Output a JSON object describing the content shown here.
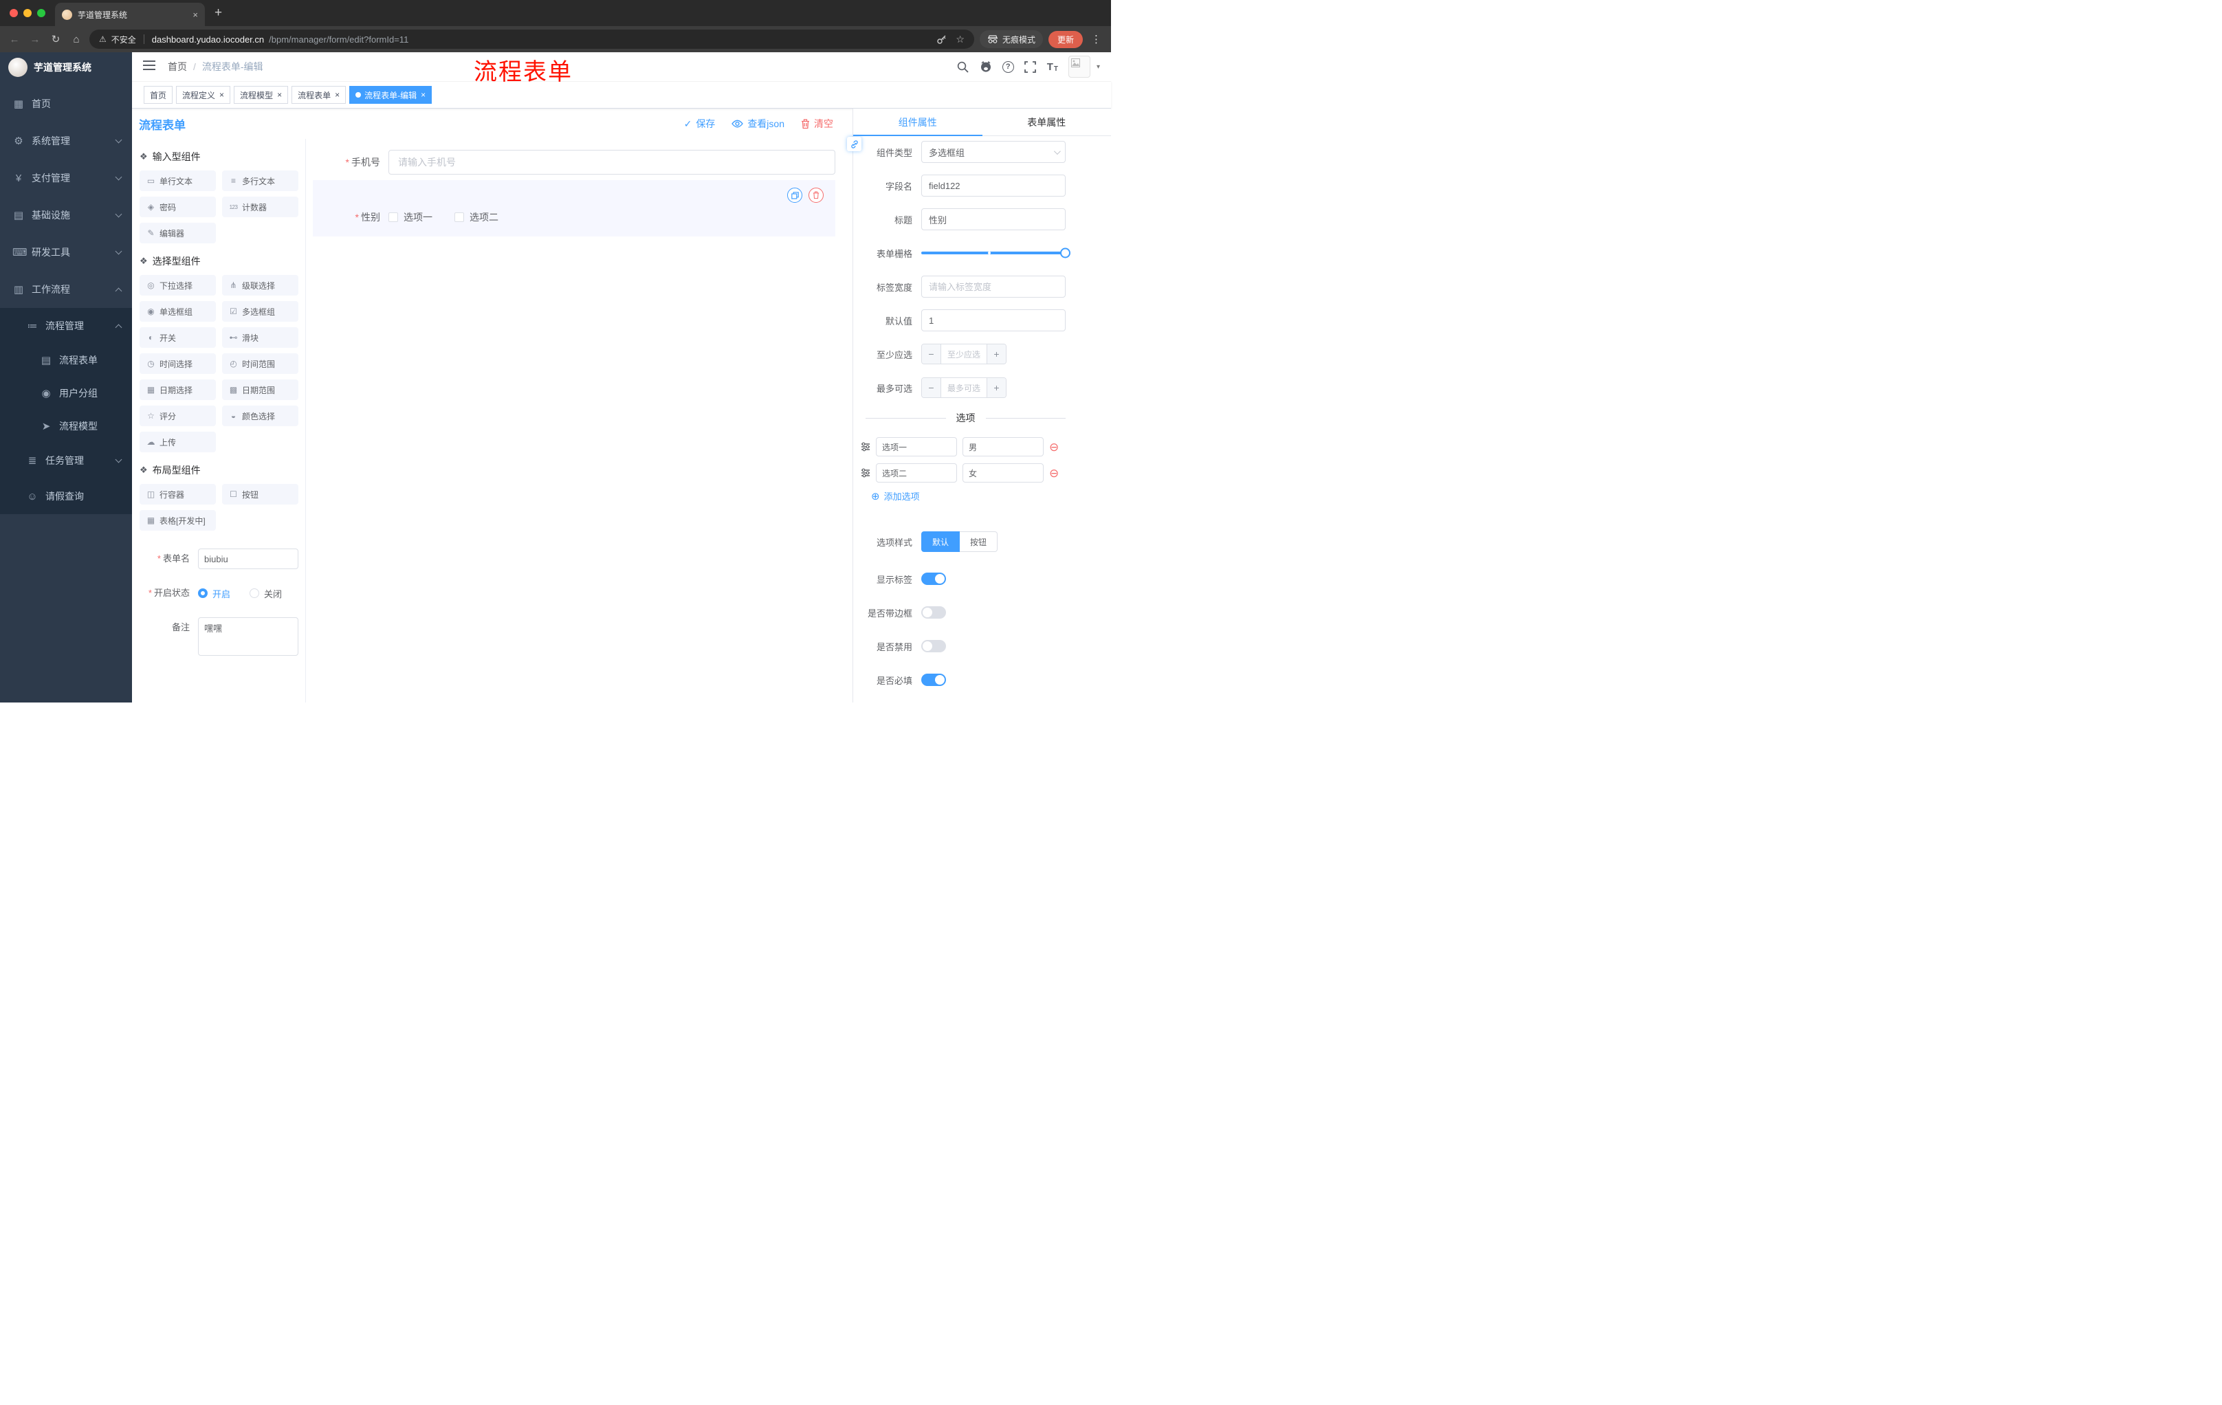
{
  "ui": {
    "asterisk": "*",
    "slash": "/",
    "close": "×",
    "plus_tab": "+",
    "dots": "⋮",
    "caret": "▾",
    "arrow_back": "←",
    "arrow_forward": "→",
    "reload": "↻",
    "home": "⌂",
    "warning": "⚠",
    "star": "☆",
    "minus": "−",
    "plus": "+",
    "add_circle": "⊕",
    "remove_circle": "⊖",
    "check": "✓",
    "question": "?",
    "t": "T"
  },
  "colors": {
    "accent": "#409eff",
    "danger": "#f56c6c",
    "annotation_red": "#ff1200",
    "sidebar_bg": "#2d3a4b",
    "submenu_bg": "#1f2d3d"
  },
  "browser": {
    "tab": {
      "title": "芋道管理系统"
    },
    "address": {
      "security": "不安全",
      "url_host": "dashboard.yudao.iocoder.cn",
      "url_path": "/bpm/manager/form/edit?formId=11"
    },
    "incognito": "无痕模式",
    "update": "更新"
  },
  "sidebar": {
    "logo_title": "芋道管理系统",
    "items": [
      {
        "label": "首页",
        "icon": "▦"
      },
      {
        "label": "系统管理",
        "icon": "⚙"
      },
      {
        "label": "支付管理",
        "icon": "¥"
      },
      {
        "label": "基础设施",
        "icon": "▤"
      },
      {
        "label": "研发工具",
        "icon": "⌨"
      },
      {
        "label": "工作流程",
        "icon": "▥"
      },
      {
        "label": "流程管理",
        "icon": "≔"
      },
      {
        "label": "流程表单",
        "icon": "▤"
      },
      {
        "label": "用户分组",
        "icon": "◉"
      },
      {
        "label": "流程模型",
        "icon": "➤"
      },
      {
        "label": "任务管理",
        "icon": "≣"
      },
      {
        "label": "请假查询",
        "icon": "☺"
      }
    ]
  },
  "header": {
    "breadcrumb": {
      "home": "首页",
      "current": "流程表单-编辑"
    },
    "annotation": "流程表单"
  },
  "tags": [
    {
      "label": "首页"
    },
    {
      "label": "流程定义"
    },
    {
      "label": "流程模型"
    },
    {
      "label": "流程表单"
    },
    {
      "label": "流程表单-编辑"
    }
  ],
  "designer": {
    "title": "流程表单",
    "actions": {
      "save": "保存",
      "view_json": "查看json",
      "clear": "清空"
    },
    "groups": [
      {
        "title": "输入型组件",
        "items": [
          {
            "icon": "▭",
            "label": "单行文本"
          },
          {
            "icon": "≡",
            "label": "多行文本"
          },
          {
            "icon": "◈",
            "label": "密码"
          },
          {
            "icon": "123",
            "label": "计数器"
          },
          {
            "icon": "✎",
            "label": "编辑器"
          }
        ]
      },
      {
        "title": "选择型组件",
        "items": [
          {
            "icon": "◎",
            "label": "下拉选择"
          },
          {
            "icon": "⋔",
            "label": "级联选择"
          },
          {
            "icon": "◉",
            "label": "单选框组"
          },
          {
            "icon": "☑",
            "label": "多选框组"
          },
          {
            "icon": "◐",
            "label": "开关"
          },
          {
            "icon": "⊷",
            "label": "滑块"
          },
          {
            "icon": "◷",
            "label": "时间选择"
          },
          {
            "icon": "◴",
            "label": "时间范围"
          },
          {
            "icon": "▦",
            "label": "日期选择"
          },
          {
            "icon": "▩",
            "label": "日期范围"
          },
          {
            "icon": "☆",
            "label": "评分"
          },
          {
            "icon": "◒",
            "label": "颜色选择"
          },
          {
            "icon": "☁",
            "label": "上传"
          }
        ]
      },
      {
        "title": "布局型组件",
        "items": [
          {
            "icon": "◫",
            "label": "行容器"
          },
          {
            "icon": "☐",
            "label": "按钮"
          },
          {
            "icon": "▦",
            "label": "表格[开发中]"
          }
        ]
      }
    ],
    "meta_form": {
      "name_label": "表单名",
      "name_value": "biubiu",
      "status_label": "开启状态",
      "status_on": "开启",
      "status_off": "关闭",
      "remark_label": "备注",
      "remark_value": "嘿嘿"
    },
    "canvas": {
      "phone_label": "手机号",
      "phone_placeholder": "请输入手机号",
      "gender_label": "性别",
      "gender_option1": "选项一",
      "gender_option2": "选项二"
    }
  },
  "props": {
    "tab_component": "组件属性",
    "tab_form": "表单属性",
    "type_label": "组件类型",
    "type_value": "多选框组",
    "field_label": "字段名",
    "field_value": "field122",
    "title_label": "标题",
    "title_value": "性别",
    "grid_label": "表单栅格",
    "label_width_label": "标签宽度",
    "label_width_placeholder": "请输入标签宽度",
    "default_label": "默认值",
    "default_value": "1",
    "min_label": "至少应选",
    "min_placeholder": "至少应选",
    "max_label": "最多可选",
    "max_placeholder": "最多可选",
    "options_divider": "选项",
    "options": [
      {
        "name": "选项一",
        "value": "男"
      },
      {
        "name": "选项二",
        "value": "女"
      }
    ],
    "add_option": "添加选项",
    "style_label": "选项样式",
    "style_default": "默认",
    "style_button": "按钮",
    "switch_show_label": "显示标签",
    "switch_border": "是否带边框",
    "switch_disabled": "是否禁用",
    "switch_required": "是否必填"
  }
}
